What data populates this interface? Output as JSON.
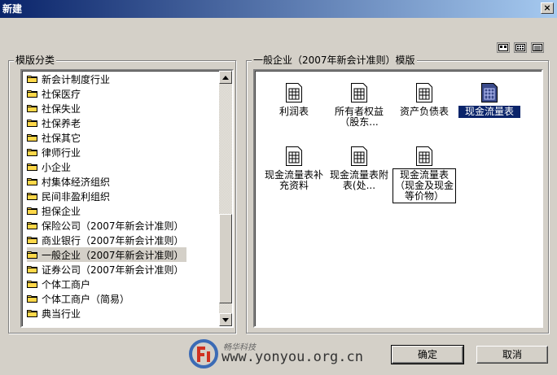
{
  "window": {
    "title": "新建",
    "close_label": "×"
  },
  "left_panel": {
    "title": "模版分类",
    "items": [
      {
        "label": "新会计制度行业"
      },
      {
        "label": "社保医疗"
      },
      {
        "label": "社保失业"
      },
      {
        "label": "社保养老"
      },
      {
        "label": "社保其它"
      },
      {
        "label": "律师行业"
      },
      {
        "label": "小企业"
      },
      {
        "label": "村集体经济组织"
      },
      {
        "label": "民间非盈利组织"
      },
      {
        "label": "担保企业"
      },
      {
        "label": "保险公司（2007年新会计准则）"
      },
      {
        "label": "商业银行（2007年新会计准则）"
      },
      {
        "label": "一般企业（2007年新会计准则）"
      },
      {
        "label": "证券公司（2007年新会计准则）"
      },
      {
        "label": "个体工商户"
      },
      {
        "label": "个体工商户（简易）"
      },
      {
        "label": "典当行业"
      }
    ]
  },
  "right_panel": {
    "title": "一般企业（2007年新会计准则）模版",
    "templates": [
      {
        "label": "利润表"
      },
      {
        "label": "所有者权益（股东..."
      },
      {
        "label": "资产负债表"
      },
      {
        "label": "现金流量表"
      },
      {
        "label": "现金流量表补充资料"
      },
      {
        "label": "现金流量表附表(处..."
      },
      {
        "label": "现金流量表（现金及现金等价物）"
      }
    ]
  },
  "buttons": {
    "ok": "确定",
    "cancel": "取消"
  },
  "watermark": {
    "brand": "畅华科技",
    "url": "www.yonyou.org.cn"
  }
}
